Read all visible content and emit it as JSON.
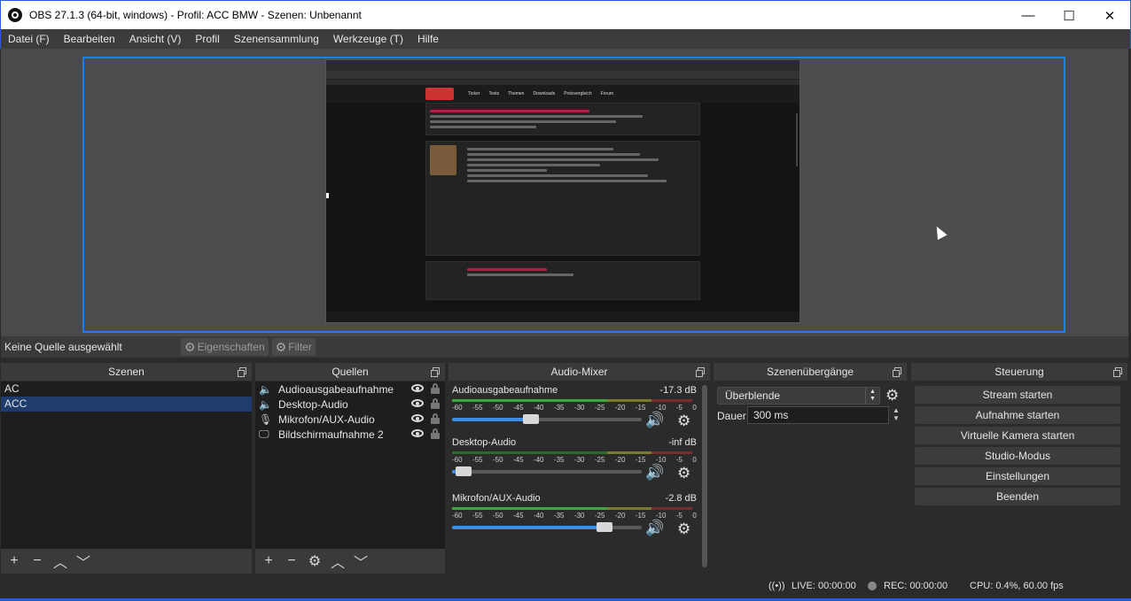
{
  "window": {
    "title": "OBS 27.1.3 (64-bit, windows) - Profil: ACC BMW - Szenen: Unbenannt",
    "minimize": "—",
    "maximize": "☐",
    "close": "✕"
  },
  "menu": [
    "Datei (F)",
    "Bearbeiten",
    "Ansicht (V)",
    "Profil",
    "Szenensammlung",
    "Werkzeuge (T)",
    "Hilfe"
  ],
  "preview": {
    "capture_nav": [
      "Ticker",
      "Tests",
      "Themen",
      "Downloads",
      "Preisvergleich",
      "Forum"
    ]
  },
  "source_toolbar": {
    "no_selection": "Keine Quelle ausgewählt",
    "properties": "Eigenschaften",
    "filter": "Filter"
  },
  "scenes": {
    "title": "Szenen",
    "items": [
      "AC",
      "ACC"
    ],
    "selected": "ACC"
  },
  "sources": {
    "title": "Quellen",
    "items": [
      {
        "label": "Audioausgabeaufnahme",
        "icon": "speaker-icon"
      },
      {
        "label": "Desktop-Audio",
        "icon": "speaker-icon"
      },
      {
        "label": "Mikrofon/AUX-Audio",
        "icon": "microphone-icon"
      },
      {
        "label": "Bildschirmaufnahme 2",
        "icon": "monitor-icon"
      }
    ]
  },
  "mixer": {
    "title": "Audio-Mixer",
    "ticks": [
      "-60",
      "-55",
      "-50",
      "-45",
      "-40",
      "-35",
      "-30",
      "-25",
      "-20",
      "-15",
      "-10",
      "-5",
      "0"
    ],
    "channels": [
      {
        "name": "Audioausgabeaufnahme",
        "level": "-17.3 dB",
        "fader": 0.41
      },
      {
        "name": "Desktop-Audio",
        "level": "-inf dB",
        "fader": 0.02
      },
      {
        "name": "Mikrofon/AUX-Audio",
        "level": "-2.8 dB",
        "fader": 0.83
      }
    ]
  },
  "transitions": {
    "title": "Szenenübergänge",
    "selected": "Überblende",
    "duration_label": "Dauer",
    "duration_value": "300 ms"
  },
  "controls": {
    "title": "Steuerung",
    "buttons": [
      "Stream starten",
      "Aufnahme starten",
      "Virtuelle Kamera starten",
      "Studio-Modus",
      "Einstellungen",
      "Beenden"
    ]
  },
  "status": {
    "live": "LIVE: 00:00:00",
    "rec": "REC: 00:00:00",
    "cpu": "CPU: 0.4%, 60.00 fps"
  }
}
